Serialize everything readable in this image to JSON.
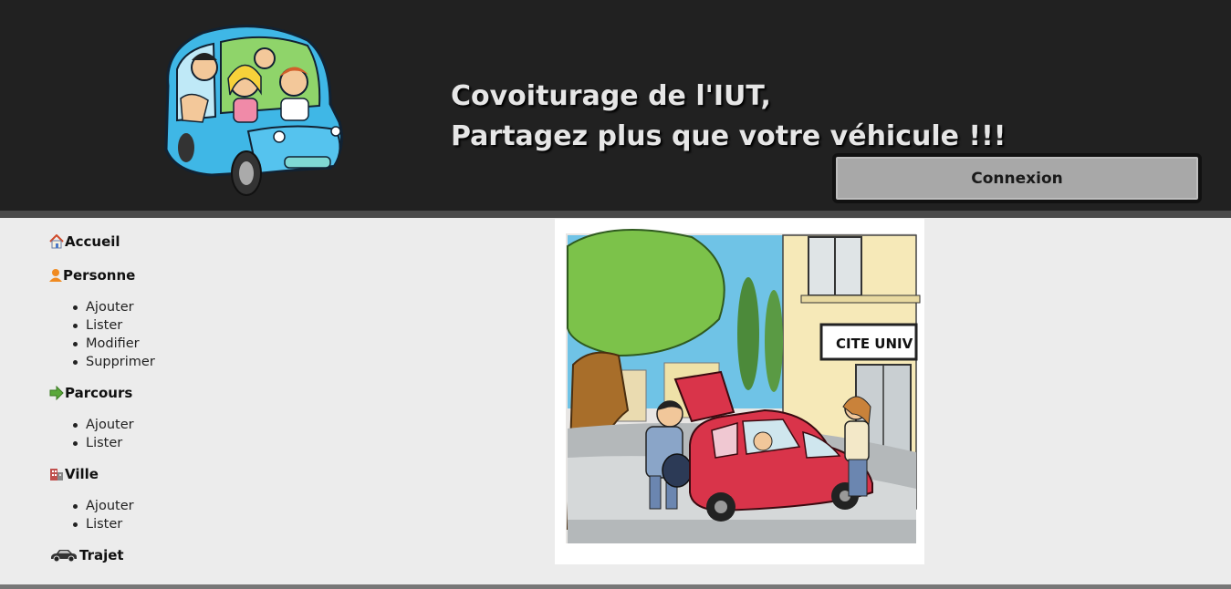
{
  "header": {
    "tagline_line1": "Covoiturage de l'IUT,",
    "tagline_line2": "Partagez plus que votre véhicule !!!",
    "login_button": "Connexion"
  },
  "menu": {
    "accueil": "Accueil",
    "personne": {
      "label": "Personne",
      "items": [
        "Ajouter",
        "Lister",
        "Modifier",
        "Supprimer"
      ]
    },
    "parcours": {
      "label": "Parcours",
      "items": [
        "Ajouter",
        "Lister"
      ]
    },
    "ville": {
      "label": "Ville",
      "items": [
        "Ajouter",
        "Lister"
      ]
    },
    "trajet": "Trajet"
  },
  "illustration": {
    "sign_text": "CITE UNIV"
  },
  "icons": {
    "accueil": "house-icon",
    "personne": "person-icon",
    "parcours": "arrow-right-icon",
    "ville": "building-icon",
    "trajet": "car-icon"
  },
  "colors": {
    "header_bg": "#212121",
    "page_bg": "#ececec",
    "button_bg": "#a8a8a8",
    "car_blue": "#3fb7e6",
    "car_red": "#d9344a"
  }
}
